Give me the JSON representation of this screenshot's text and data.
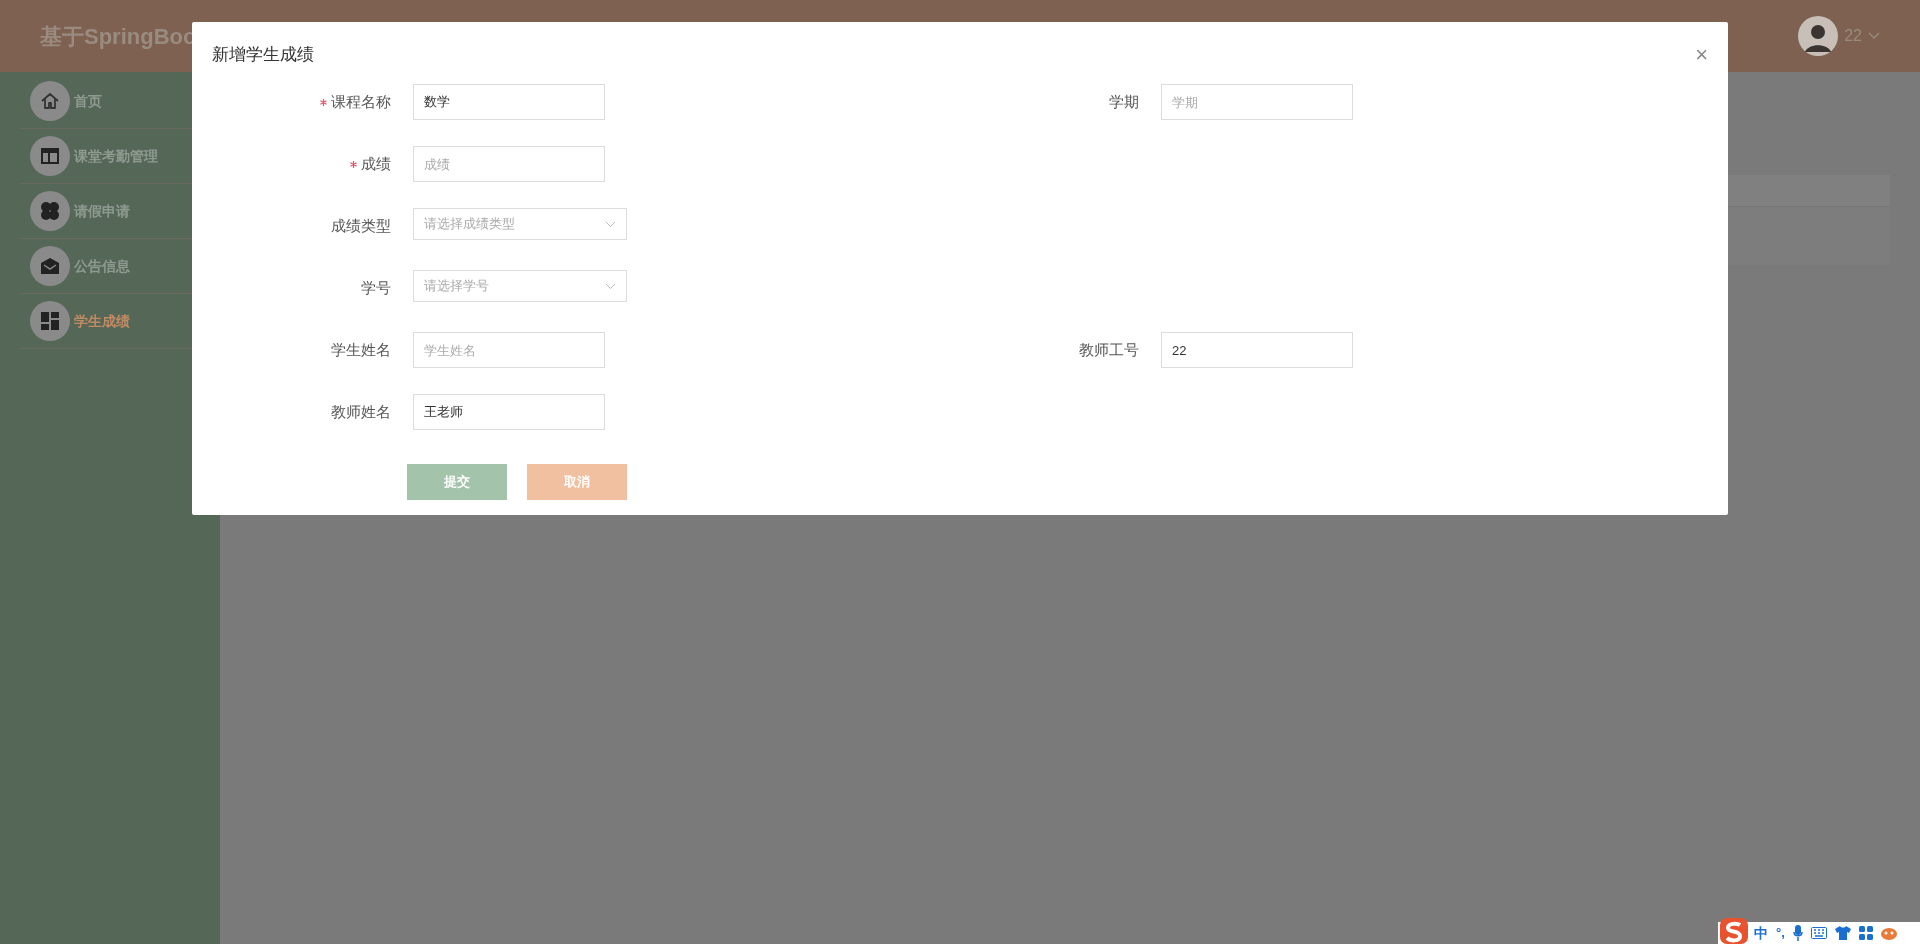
{
  "header": {
    "title": "基于SpringBoo",
    "user": "22"
  },
  "sidebar": {
    "items": [
      {
        "label": "首页",
        "selected": false
      },
      {
        "label": "课堂考勤管理",
        "selected": false
      },
      {
        "label": "请假申请",
        "selected": false
      },
      {
        "label": "公告信息",
        "selected": false
      },
      {
        "label": "学生成绩",
        "selected": true
      }
    ]
  },
  "dialog": {
    "title": "新增学生成绩",
    "close": "×",
    "rows": [
      {
        "fields": [
          {
            "label": "课程名称",
            "required": true,
            "kind": "input",
            "value": "数学"
          },
          {
            "label": "学期",
            "required": false,
            "kind": "input",
            "placeholder": "学期"
          }
        ]
      },
      {
        "fields": [
          {
            "label": "成绩",
            "required": true,
            "kind": "input",
            "placeholder": "成绩"
          }
        ]
      },
      {
        "fields": [
          {
            "label": "成绩类型",
            "required": false,
            "kind": "select",
            "placeholder": "请选择成绩类型"
          }
        ]
      },
      {
        "fields": [
          {
            "label": "学号",
            "required": false,
            "kind": "select",
            "placeholder": "请选择学号"
          }
        ]
      },
      {
        "fields": [
          {
            "label": "学生姓名",
            "required": false,
            "kind": "input",
            "placeholder": "学生姓名"
          },
          {
            "label": "教师工号",
            "required": false,
            "kind": "input",
            "value": "22"
          }
        ]
      },
      {
        "fields": [
          {
            "label": "教师姓名",
            "required": false,
            "kind": "input",
            "value": "王老师"
          }
        ]
      }
    ],
    "buttons": [
      {
        "label": "提交",
        "kind": "primary"
      },
      {
        "label": "取消",
        "kind": "cancel"
      }
    ]
  },
  "ime_bar": {
    "mode": "中",
    "punctuation": "°,"
  }
}
